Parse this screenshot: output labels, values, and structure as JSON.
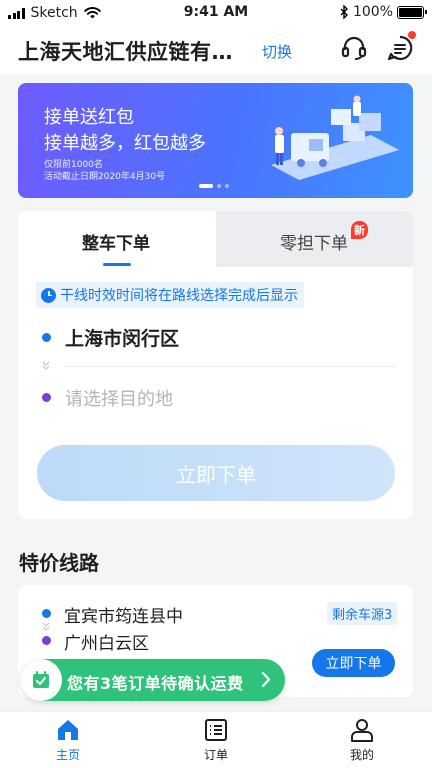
{
  "status_bar": {
    "carrier": "Sketch",
    "time": "9:41 AM",
    "battery": "100%",
    "battery_level": 1.0
  },
  "header": {
    "company": "上海天地汇供应链有…",
    "switch_label": "切换",
    "support_icon": "headset-icon",
    "message_icon": "message-icon",
    "has_unread": true
  },
  "banner": {
    "title": "接单送红包",
    "subtitle": "接单越多，红包越多",
    "note1": "仅限前1000名",
    "note2": "活动截止日期2020年4月30号",
    "page_count": 3,
    "active_page": 1
  },
  "order_card": {
    "tabs": [
      {
        "label": "整车下单",
        "active": true
      },
      {
        "label": "零担下单",
        "active": false,
        "badge": "新"
      }
    ],
    "notice": "干线时效时间将在路线选择完成后显示",
    "origin": "上海市闵行区",
    "destination_placeholder": "请选择目的地",
    "submit_label": "立即下单"
  },
  "special_routes": {
    "title": "特价线路",
    "items": [
      {
        "from": "宜宾市筠连县中",
        "to": "广州白云区",
        "remaining": "剩余车源3",
        "action": "立即下单"
      }
    ]
  },
  "floating_tip": {
    "text": "您有3笔订单待确认运费"
  },
  "tabbar": {
    "items": [
      {
        "label": "主页",
        "icon": "home-icon",
        "active": true
      },
      {
        "label": "订单",
        "icon": "order-list-icon",
        "active": false
      },
      {
        "label": "我的",
        "icon": "user-icon",
        "active": false
      }
    ]
  },
  "colors": {
    "accent": "#1677e8",
    "green": "#2fc27a",
    "red": "#ff3b30",
    "origin_dot": "#1677e8",
    "dest_dot": "#7a3fd6"
  }
}
